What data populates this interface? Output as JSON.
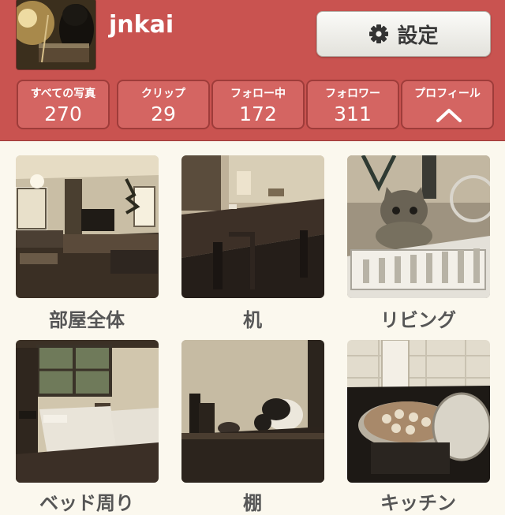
{
  "profile": {
    "username": "jnkai",
    "settings_label": "設定"
  },
  "stats": [
    {
      "label": "すべての写真",
      "value": "270"
    },
    {
      "label": "クリップ",
      "value": "29"
    },
    {
      "label": "フォロー中",
      "value": "172"
    },
    {
      "label": "フォロワー",
      "value": "311"
    },
    {
      "label": "プロフィール",
      "icon": "chevron-up-icon"
    }
  ],
  "albums": [
    {
      "caption": "部屋全体"
    },
    {
      "caption": "机"
    },
    {
      "caption": "リビング"
    },
    {
      "caption": "ベッド周り"
    },
    {
      "caption": "棚"
    },
    {
      "caption": "キッチン"
    }
  ],
  "colors": {
    "header_bg": "#c95350",
    "stat_bg": "#d46562",
    "page_bg": "#fbf8ee",
    "caption_text": "#565656"
  }
}
